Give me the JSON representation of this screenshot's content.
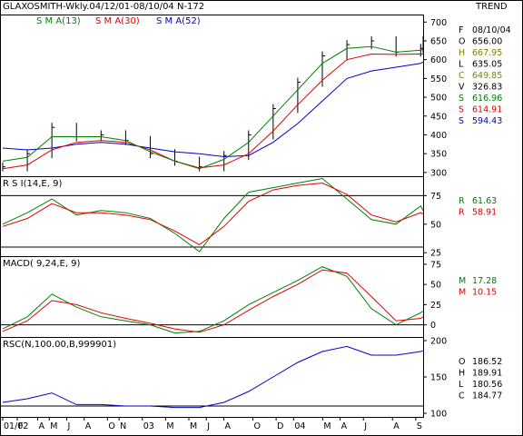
{
  "header": {
    "title": "GLAXOSMITH-Wkly.04/12/01-08/10/04  N-172",
    "trend": "TREND"
  },
  "colors": {
    "price": "#000000",
    "sma13": "#008000",
    "sma30": "#e00000",
    "sma52": "#0000cc",
    "rsc": "#0000cc",
    "frame": "#000000"
  },
  "chart_data": [
    {
      "panel": "price",
      "type": "line",
      "legend": [
        {
          "label": "S M A(13)",
          "color": "#008000"
        },
        {
          "label": "S M A(30)",
          "color": "#e00000"
        },
        {
          "label": "S M A(52)",
          "color": "#0000cc"
        }
      ],
      "ylim": [
        290,
        720
      ],
      "yticks": [
        "700",
        "650",
        "600",
        "550",
        "500",
        "450",
        "400",
        "350",
        "300"
      ],
      "ytick_values": [
        700,
        650,
        600,
        550,
        500,
        450,
        400,
        350,
        300
      ],
      "x": [
        0,
        10,
        20,
        30,
        40,
        50,
        60,
        70,
        80,
        90,
        100,
        110,
        120,
        130,
        140,
        150,
        160,
        170,
        171
      ],
      "close": [
        315,
        350,
        420,
        395,
        400,
        385,
        350,
        330,
        315,
        345,
        400,
        470,
        540,
        610,
        640,
        650,
        620,
        630,
        650
      ],
      "sma13": [
        330,
        340,
        395,
        395,
        395,
        385,
        355,
        330,
        310,
        335,
        380,
        450,
        520,
        590,
        630,
        635,
        620,
        625,
        627
      ],
      "sma30": [
        310,
        320,
        360,
        380,
        385,
        380,
        360,
        330,
        312,
        320,
        350,
        410,
        480,
        545,
        600,
        615,
        614,
        615,
        615
      ],
      "sma52": [
        365,
        360,
        365,
        375,
        380,
        375,
        365,
        355,
        350,
        342,
        345,
        380,
        430,
        490,
        550,
        570,
        580,
        590,
        594
      ],
      "readout": [
        {
          "key": "F",
          "value": "08/10/04",
          "color": "#000000"
        },
        {
          "key": "O",
          "value": "656.00",
          "color": "#000000"
        },
        {
          "key": "H",
          "value": "667.95",
          "color": "#808000"
        },
        {
          "key": "L",
          "value": "635.05",
          "color": "#000000"
        },
        {
          "key": "C",
          "value": "649.85",
          "color": "#808000"
        },
        {
          "key": "V",
          "value": "326.83",
          "color": "#000000"
        },
        {
          "key": "S",
          "value": "616.96",
          "color": "#008000"
        },
        {
          "key": "S",
          "value": "614.91",
          "color": "#e00000"
        },
        {
          "key": "S",
          "value": "594.43",
          "color": "#0000cc"
        }
      ]
    },
    {
      "panel": "rsi",
      "type": "line",
      "title": "R S I(14,E, 9)",
      "ylim": [
        22,
        92
      ],
      "yticks": [
        "75",
        "50",
        "25"
      ],
      "ytick_values": [
        75,
        50,
        25
      ],
      "hlines": [
        75,
        30
      ],
      "x": [
        0,
        10,
        20,
        30,
        40,
        50,
        60,
        70,
        80,
        90,
        100,
        110,
        120,
        130,
        140,
        150,
        160,
        170,
        171
      ],
      "series": [
        {
          "name": "R",
          "color": "#008000",
          "values": [
            50,
            60,
            72,
            58,
            62,
            60,
            55,
            42,
            26,
            55,
            78,
            82,
            86,
            90,
            72,
            54,
            50,
            66,
            62
          ]
        },
        {
          "name": "R",
          "color": "#e00000",
          "values": [
            48,
            55,
            68,
            60,
            60,
            58,
            54,
            44,
            32,
            48,
            70,
            80,
            84,
            86,
            76,
            58,
            52,
            60,
            59
          ]
        }
      ],
      "readout": [
        {
          "key": "R",
          "value": "61.63",
          "color": "#008000"
        },
        {
          "key": "R",
          "value": "58.91",
          "color": "#e00000"
        }
      ]
    },
    {
      "panel": "macd",
      "type": "line",
      "title": "MACD( 9,24,E, 9)",
      "ylim": [
        -15,
        85
      ],
      "yticks": [
        "75",
        "50",
        "25",
        "0"
      ],
      "ytick_values": [
        75,
        50,
        25,
        0
      ],
      "hlines": [
        0
      ],
      "x": [
        0,
        10,
        20,
        30,
        40,
        50,
        60,
        70,
        80,
        90,
        100,
        110,
        120,
        130,
        140,
        150,
        160,
        170,
        171
      ],
      "series": [
        {
          "name": "M",
          "color": "#008000",
          "values": [
            -5,
            10,
            38,
            22,
            10,
            5,
            0,
            -10,
            -8,
            5,
            25,
            40,
            55,
            72,
            60,
            20,
            0,
            15,
            17
          ]
        },
        {
          "name": "M",
          "color": "#e00000",
          "values": [
            -8,
            5,
            30,
            25,
            15,
            8,
            2,
            -5,
            -9,
            0,
            18,
            35,
            50,
            68,
            64,
            35,
            5,
            8,
            10
          ]
        }
      ],
      "readout": [
        {
          "key": "M",
          "value": "17.28",
          "color": "#008000"
        },
        {
          "key": "M",
          "value": "10.15",
          "color": "#e00000"
        }
      ]
    },
    {
      "panel": "rsc",
      "type": "line",
      "title": "RSC(N,100.00,B,999901)",
      "ylim": [
        95,
        205
      ],
      "yticks": [
        "200",
        "150",
        "100"
      ],
      "ytick_values": [
        200,
        150,
        100
      ],
      "hlines": [
        110
      ],
      "x": [
        0,
        10,
        20,
        30,
        40,
        50,
        60,
        70,
        80,
        90,
        100,
        110,
        120,
        130,
        140,
        150,
        160,
        170,
        171
      ],
      "series": [
        {
          "name": "RSC",
          "color": "#0000cc",
          "values": [
            115,
            120,
            128,
            112,
            112,
            110,
            110,
            108,
            108,
            115,
            130,
            150,
            170,
            185,
            192,
            180,
            180,
            185,
            186
          ]
        }
      ],
      "readout": [
        {
          "key": "O",
          "value": "186.52",
          "color": "#000000"
        },
        {
          "key": "H",
          "value": "189.91",
          "color": "#000000"
        },
        {
          "key": "L",
          "value": "180.56",
          "color": "#000000"
        },
        {
          "key": "C",
          "value": "184.77",
          "color": "#000000"
        }
      ]
    }
  ],
  "xaxis": {
    "labels": [
      "01/02",
      "F",
      "A",
      "M",
      "J",
      "A",
      "O",
      "N",
      "03",
      "M",
      "M",
      "J",
      "A",
      "O",
      "D",
      "04",
      "M",
      "A",
      "J",
      "A",
      "S"
    ],
    "label_x": [
      0,
      5,
      12,
      16,
      22,
      28,
      36,
      40,
      48,
      56,
      64,
      70,
      76,
      86,
      94,
      100,
      110,
      116,
      124,
      134,
      142
    ]
  }
}
